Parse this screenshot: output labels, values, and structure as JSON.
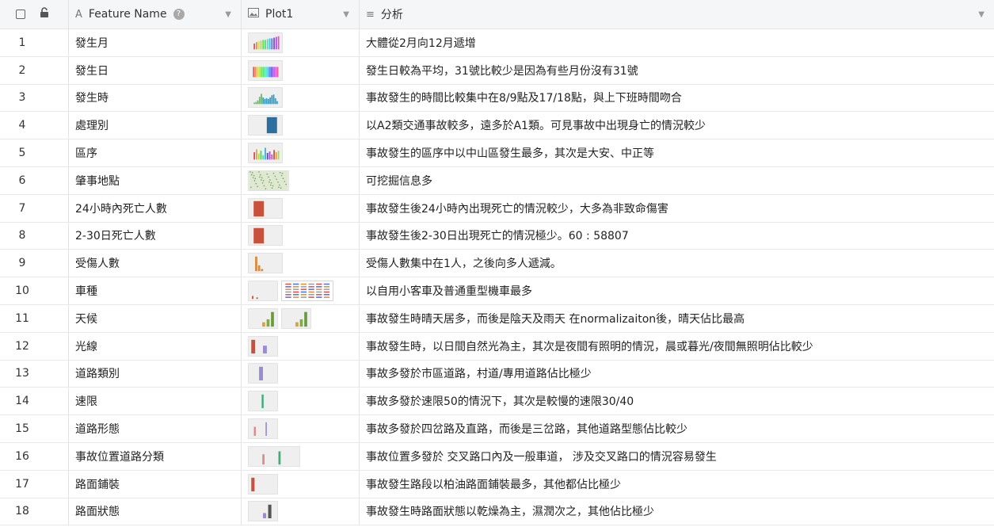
{
  "header": {
    "name_label": "Feature Name",
    "plot_label": "Plot1",
    "analysis_label": "分析"
  },
  "rows": [
    {
      "no": "1",
      "name": "發生月",
      "analysis": "大體從2月向12月遞增",
      "plot": "bars-rainbow"
    },
    {
      "no": "2",
      "name": "發生日",
      "analysis": "發生日較為平均，31號比較少是因為有些月份沒有31號",
      "plot": "bars-rainbow-dense"
    },
    {
      "no": "3",
      "name": "發生時",
      "analysis": "事故發生的時間比較集中在8/9點及17/18點，與上下班時間吻合",
      "plot": "bars-hour"
    },
    {
      "no": "4",
      "name": "處理別",
      "analysis": "以A2類交通事故較多，遠多於A1類。可見事故中出現身亡的情況較少",
      "plot": "bar-blue"
    },
    {
      "no": "5",
      "name": "區序",
      "analysis": "事故發生的區序中以中山區發生最多，其次是大安、中正等",
      "plot": "bars-district"
    },
    {
      "no": "6",
      "name": "肇事地點",
      "analysis": "可挖掘信息多",
      "plot": "map"
    },
    {
      "no": "7",
      "name": "24小時內死亡人數",
      "analysis": "事故發生後24小時內出現死亡的情況較少，大多為非致命傷害",
      "plot": "bar-red"
    },
    {
      "no": "8",
      "name": "2-30日死亡人數",
      "analysis": "事故發生後2-30日出現死亡的情況極少。60 : 58807",
      "plot": "bar-red"
    },
    {
      "no": "9",
      "name": "受傷人數",
      "analysis": "受傷人數集中在1人，之後向多人遞減。",
      "plot": "bars-injury"
    },
    {
      "no": "10",
      "name": "車種",
      "analysis": "以自用小客車及普通重型機車最多",
      "plot": "vehicle"
    },
    {
      "no": "11",
      "name": "天候",
      "analysis": "事故發生時晴天居多，而後是陰天及雨天 在normalizaiton後，晴天佔比最高",
      "plot": "weather"
    },
    {
      "no": "12",
      "name": "光線",
      "analysis": "事故發生時，以日間自然光為主，其次是夜間有照明的情況，晨或暮光/夜間無照明佔比較少",
      "plot": "light"
    },
    {
      "no": "13",
      "name": "道路類別",
      "analysis": "事故多發於市區道路，村道/專用道路佔比極少",
      "plot": "road-class"
    },
    {
      "no": "14",
      "name": "速限",
      "analysis": "事故多發於速限50的情況下，其次是較慢的速限30/40",
      "plot": "speed"
    },
    {
      "no": "15",
      "name": "道路形態",
      "analysis": "事故多發於四岔路及直路，而後是三岔路，其他道路型態佔比較少",
      "plot": "road-shape"
    },
    {
      "no": "16",
      "name": "事故位置道路分類",
      "analysis": "事故位置多發於 交叉路口內及一般車道， 涉及交叉路口的情況容易發生",
      "plot": "position"
    },
    {
      "no": "17",
      "name": "路面鋪裝",
      "analysis": "事故發生路段以柏油路面鋪裝最多，其他都佔比極少",
      "plot": "pavement"
    },
    {
      "no": "18",
      "name": "路面狀態",
      "analysis": "事故發生時路面狀態以乾燥為主，濕潤次之，其他佔比極少",
      "plot": "surface"
    }
  ]
}
